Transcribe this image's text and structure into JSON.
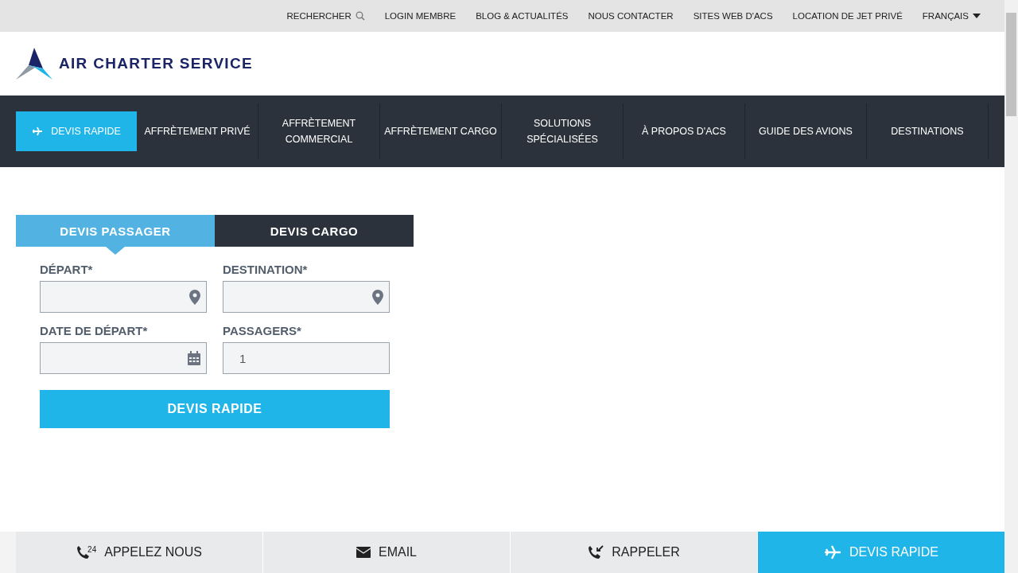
{
  "top_links": [
    {
      "label": "RECHERCHER",
      "kind": "search"
    },
    {
      "label": "LOGIN MEMBRE",
      "kind": "link"
    },
    {
      "label": "BLOG & ACTUALITÉS",
      "kind": "link"
    },
    {
      "label": "NOUS CONTACTER",
      "kind": "link"
    },
    {
      "label": "SITES WEB D'ACS",
      "kind": "link"
    },
    {
      "label": "LOCATION DE JET PRIVÉ",
      "kind": "link"
    },
    {
      "label": "FRANÇAIS",
      "kind": "dropdown"
    }
  ],
  "logo": {
    "text": "AIR CHARTER SERVICE"
  },
  "main_nav": [
    {
      "label": "DEVIS RAPIDE",
      "kind": "cta"
    },
    {
      "label": "AFFRÈTEMENT PRIVÉ",
      "kind": "link"
    },
    {
      "label": "AFFRÈTEMENT COMMERCIAL",
      "kind": "link"
    },
    {
      "label": "AFFRÈTEMENT CARGO",
      "kind": "link"
    },
    {
      "label": "SOLUTIONS SPÉCIALISÉES",
      "kind": "link"
    },
    {
      "label": "À PROPOS D'ACS",
      "kind": "link"
    },
    {
      "label": "GUIDE DES AVIONS",
      "kind": "link"
    },
    {
      "label": "DESTINATIONS",
      "kind": "link"
    }
  ],
  "quote_tabs": [
    {
      "label": "DEVIS PASSAGER",
      "selected": true
    },
    {
      "label": "DEVIS CARGO",
      "selected": false
    }
  ],
  "fields": [
    {
      "label": "DÉPART*",
      "kind": "location"
    },
    {
      "label": "DESTINATION*",
      "kind": "location"
    },
    {
      "label": "DATE DE DÉPART*",
      "kind": "date"
    },
    {
      "label": "PASSAGERS*",
      "kind": "number",
      "value": "1"
    }
  ],
  "submit": "DEVIS RAPIDE",
  "bottom_bar": [
    {
      "label": "APPELEZ NOUS",
      "kind": "call",
      "badge": "24"
    },
    {
      "label": "EMAIL",
      "kind": "email"
    },
    {
      "label": "RAPPELER",
      "kind": "callback"
    },
    {
      "label": "DEVIS RAPIDE",
      "kind": "quote"
    }
  ]
}
